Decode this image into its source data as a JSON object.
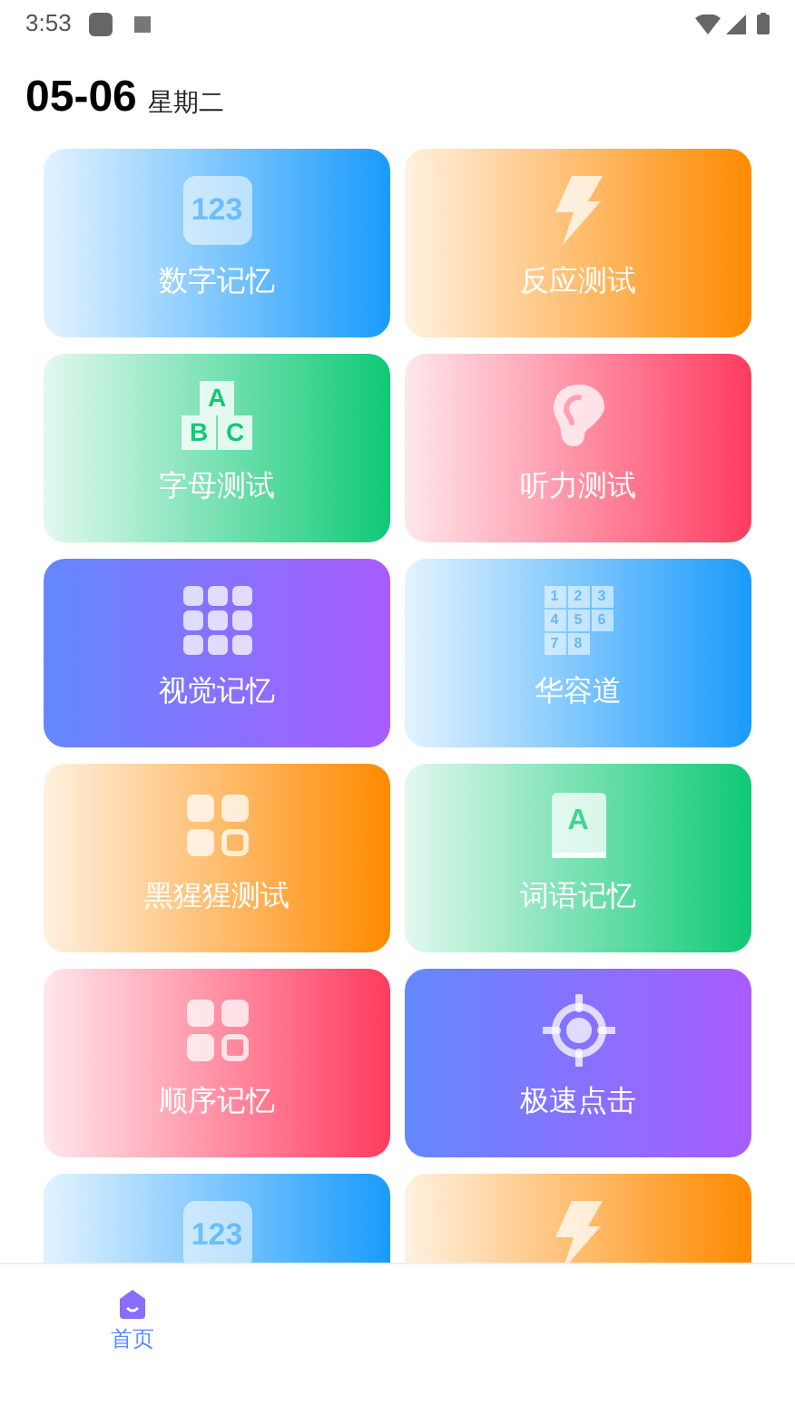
{
  "status_bar": {
    "time": "3:53"
  },
  "header": {
    "date": "05-06",
    "weekday": "星期二"
  },
  "card_rows": [
    {
      "cards": [
        {
          "title": "数字记忆",
          "color": "#1a9bfc",
          "kind": "fade",
          "icon": {
            "kind": "digits",
            "texts": [
              "123"
            ]
          }
        },
        {
          "title": "反应测试",
          "color": "#ff8a00",
          "kind": "fade",
          "icon": {
            "kind": "bolt"
          }
        }
      ]
    },
    {
      "cards": [
        {
          "title": "字母测试",
          "color": "#0fc976",
          "kind": "fade",
          "icon": {
            "kind": "blocks",
            "texts": [
              "A",
              "B",
              "C"
            ]
          }
        },
        {
          "title": "听力测试",
          "color": "#ff3b5f",
          "kind": "fade",
          "icon": {
            "kind": "ear"
          }
        }
      ]
    },
    {
      "cards": [
        {
          "title": "视觉记忆",
          "color": "#a95cff",
          "kind": "solid",
          "icon": {
            "kind": "dots"
          }
        },
        {
          "title": "华容道",
          "color": "#1a9bfc",
          "kind": "fade",
          "icon": {
            "kind": "puzzle",
            "texts": [
              "1",
              "2",
              "3",
              "4",
              "5",
              "6",
              "7",
              "8"
            ]
          }
        }
      ]
    },
    {
      "cards": [
        {
          "title": "黑猩猩测试",
          "color": "#ff8a00",
          "kind": "fade",
          "icon": {
            "kind": "tiles"
          }
        },
        {
          "title": "词语记忆",
          "color": "#0fc976",
          "kind": "fade",
          "icon": {
            "kind": "book",
            "texts": [
              "A"
            ]
          }
        }
      ]
    },
    {
      "cards": [
        {
          "title": "顺序记忆",
          "color": "#ff3b5f",
          "kind": "fade",
          "icon": {
            "kind": "tiles"
          }
        },
        {
          "title": "极速点击",
          "color": "#a95cff",
          "kind": "solid",
          "icon": {
            "kind": "target"
          }
        }
      ]
    },
    {
      "cards": [
        {
          "color": "#1a9bfc",
          "kind": "fade",
          "icon": {
            "kind": "digits",
            "texts": [
              "123"
            ]
          }
        },
        {
          "color": "#ff8a00",
          "kind": "fade",
          "icon": {
            "kind": "bolt"
          }
        }
      ]
    }
  ],
  "tab_bar": [
    {
      "label": "首页",
      "selected": true
    }
  ]
}
